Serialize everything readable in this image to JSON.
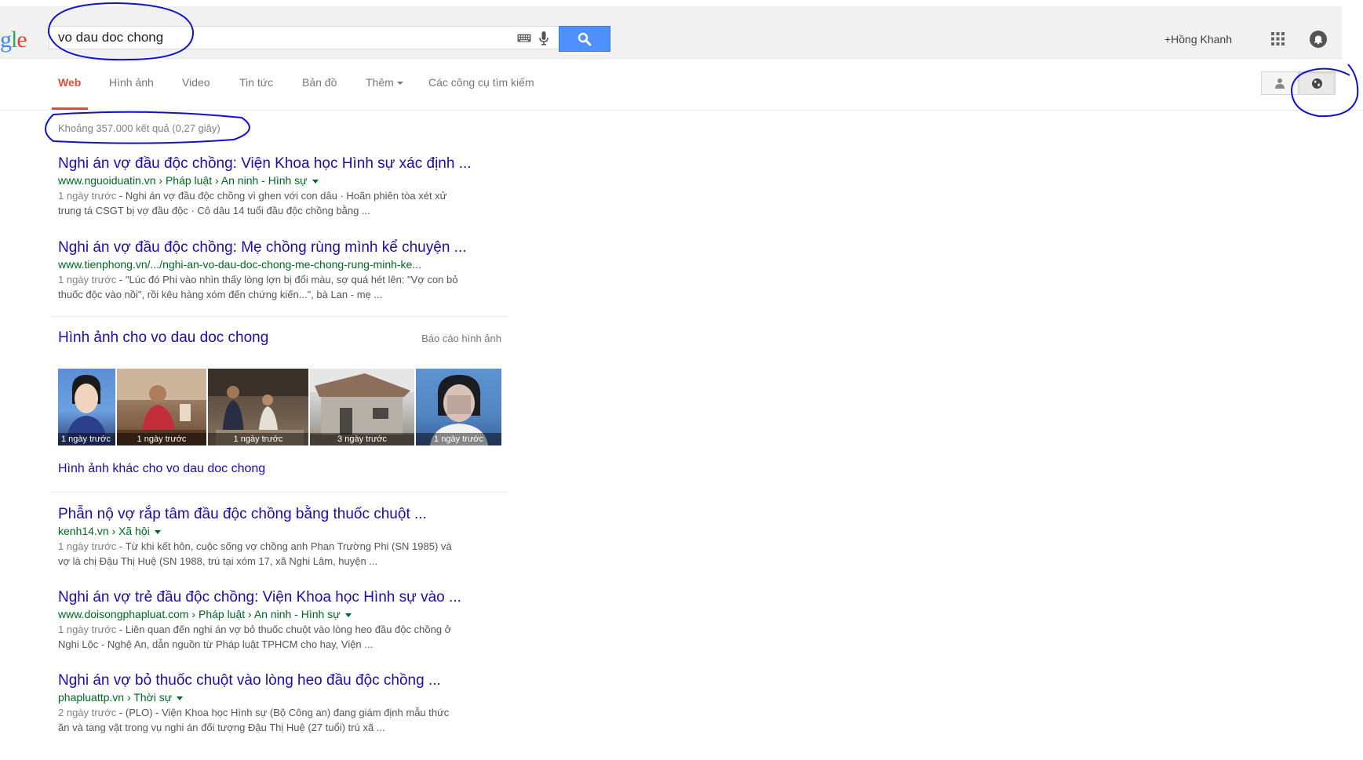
{
  "header": {
    "logo_partial": "gle",
    "search_value": "vo dau doc chong",
    "user_name": "+Hồng Khanh"
  },
  "tabs": [
    {
      "label": "Web",
      "active": true
    },
    {
      "label": "Hình ảnh",
      "active": false
    },
    {
      "label": "Video",
      "active": false
    },
    {
      "label": "Tin tức",
      "active": false
    },
    {
      "label": "Bản đồ",
      "active": false
    },
    {
      "label": "Thêm",
      "active": false
    },
    {
      "label": "Các công cụ tìm kiếm",
      "active": false
    }
  ],
  "result_stats": "Khoảng 357.000 kết quả (0,27 giây)",
  "results_top": [
    {
      "title": "Nghi án vợ đầu độc chồng: Viện Khoa học Hình sự xác định ...",
      "url": "www.nguoiduatin.vn › Pháp luật › An ninh - Hình sự",
      "date": "1 ngày trước",
      "snippet_line1": " - Nghi án vợ đầu độc chồng vì ghen với con dâu · Hoãn phiên tòa xét xử",
      "snippet_line2": "trung tá CSGT bị vợ đầu độc · Cô dâu 14 tuổi đầu độc chồng bằng ..."
    },
    {
      "title": "Nghi án vợ đầu độc chồng: Mẹ chồng rùng mình kể chuyện ...",
      "url": "www.tienphong.vn/.../nghi-an-vo-dau-doc-chong-me-chong-rung-minh-ke...",
      "date": "1 ngày trước",
      "snippet_line1": " - \"Lúc đó Phi vào nhìn thấy lòng lợn bị đổi màu, sợ quá hét lên: \"Vợ con bỏ",
      "snippet_line2": "thuốc độc vào nồi\", rồi kêu hàng xóm đến chứng kiến...\", bà Lan - mẹ ..."
    }
  ],
  "images": {
    "title": "Hình ảnh cho vo dau doc chong",
    "report": "Báo cáo hình ảnh",
    "captions": [
      "1 ngày trước",
      "1 ngày trước",
      "1 ngày trước",
      "3 ngày trước",
      "1 ngày trước"
    ],
    "more": "Hình ảnh khác cho vo dau doc chong"
  },
  "results_bottom": [
    {
      "title": "Phẫn nộ vợ rắp tâm đầu độc chồng bằng thuốc chuột ...",
      "url": "kenh14.vn › Xã hội",
      "date": "1 ngày trước",
      "snippet_line1": " - Từ khi kết hôn, cuộc sống vợ chồng anh Phan Trường Phi (SN 1985) và",
      "snippet_line2": "vợ là chị Đậu Thị Huệ (SN 1988, trú tại xóm 17, xã Nghi Lâm, huyện ..."
    },
    {
      "title": "Nghi án vợ trẻ đầu độc chồng: Viện Khoa học Hình sự vào ...",
      "url": "www.doisongphapluat.com › Pháp luật › An ninh - Hình sự",
      "date": "1 ngày trước",
      "snippet_line1": " - Liên quan đến nghi án vợ bỏ thuốc chuột vào lòng heo đầu độc chồng ở",
      "snippet_line2": "Nghi Lộc - Nghệ An, dẫn nguồn từ Pháp luật TPHCM cho hay, Viện ..."
    },
    {
      "title": "Nghi án vợ bỏ thuốc chuột vào lòng heo đầu độc chồng ...",
      "url": "phapluattp.vn › Thời sự",
      "date": "2 ngày trước",
      "snippet_line1": " - (PLO) - Viện Khoa học Hình sự (Bộ Công an) đang giám định mẫu thức",
      "snippet_line2": "ăn và tang vật trong vụ nghi án đối tượng Đậu Thị Huệ (27 tuổi) trú xã ..."
    }
  ],
  "colors": {
    "link": "#1a0dab",
    "url_green": "#006621",
    "active_tab": "#dd4b39",
    "search_blue": "#4d90fe",
    "annotation_ink": "#1010d0"
  }
}
